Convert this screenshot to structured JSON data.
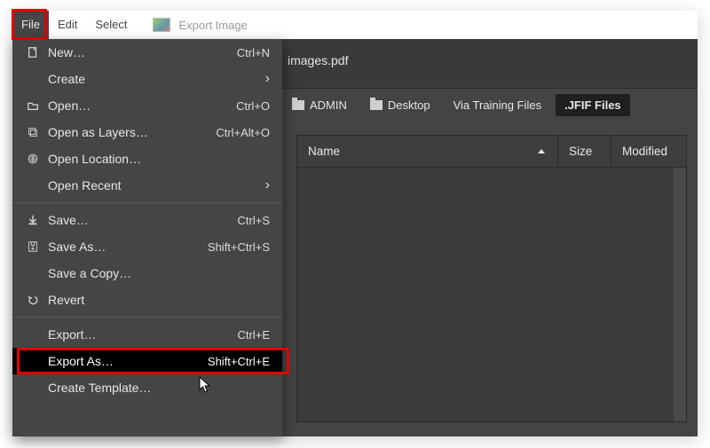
{
  "menubar": {
    "file": "File",
    "edit": "Edit",
    "select": "Select",
    "doc_title": "Export Image"
  },
  "dialog": {
    "filename": "images.pdf",
    "path": [
      {
        "label": "ADMIN",
        "icon": "folder",
        "active": false
      },
      {
        "label": "Desktop",
        "icon": "folder",
        "active": false
      },
      {
        "label": "Via Training Files",
        "icon": null,
        "active": false
      },
      {
        "label": ".JFIF Files",
        "icon": null,
        "active": true
      }
    ],
    "columns": {
      "name": "Name",
      "size": "Size",
      "modified": "Modified"
    }
  },
  "file_menu": {
    "groups": [
      [
        {
          "icon": "new",
          "label": "New…",
          "accel": "Ctrl+N",
          "submenu": false
        },
        {
          "icon": "",
          "label": "Create",
          "accel": "",
          "submenu": true
        },
        {
          "icon": "open",
          "label": "Open…",
          "accel": "Ctrl+O",
          "submenu": false
        },
        {
          "icon": "layers",
          "label": "Open as Layers…",
          "accel": "Ctrl+Alt+O",
          "submenu": false
        },
        {
          "icon": "globe",
          "label": "Open Location…",
          "accel": "",
          "submenu": false
        },
        {
          "icon": "",
          "label": "Open Recent",
          "accel": "",
          "submenu": true
        }
      ],
      [
        {
          "icon": "save",
          "label": "Save…",
          "accel": "Ctrl+S",
          "submenu": false
        },
        {
          "icon": "saveas",
          "label": "Save As…",
          "accel": "Shift+Ctrl+S",
          "submenu": false
        },
        {
          "icon": "",
          "label": "Save a Copy…",
          "accel": "",
          "submenu": false
        },
        {
          "icon": "revert",
          "label": "Revert",
          "accel": "",
          "submenu": false
        }
      ],
      [
        {
          "icon": "",
          "label": "Export…",
          "accel": "Ctrl+E",
          "submenu": false
        },
        {
          "icon": "",
          "label": "Export As…",
          "accel": "Shift+Ctrl+E",
          "submenu": false,
          "hover": true,
          "highlight": true
        },
        {
          "icon": "",
          "label": "Create Template…",
          "accel": "",
          "submenu": false
        }
      ]
    ]
  }
}
